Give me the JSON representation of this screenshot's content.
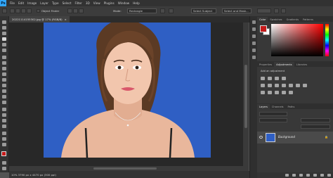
{
  "menu": [
    "File",
    "Edit",
    "Image",
    "Layer",
    "Type",
    "Select",
    "Filter",
    "3D",
    "View",
    "Plugins",
    "Window",
    "Help"
  ],
  "app_logo": "Ps",
  "options": {
    "object_finder": "Object Finder",
    "mode_label": "Mode:",
    "mode_value": "Rectangle",
    "select_subject": "Select Subject",
    "select_and_mask": "Select and Mask..."
  },
  "document": {
    "tab_title": "20221114155302.jpg @ 17% (RGB/8)",
    "status": "10%   3790 px x 4470 px (300 ppi)"
  },
  "color_panel": {
    "tabs": [
      "Color",
      "Swatches",
      "Gradients",
      "Patterns"
    ],
    "active": "Color",
    "foreground": "#c51a1a",
    "background": "#ffffff"
  },
  "adjust_panel": {
    "tabs": [
      "Properties",
      "Adjustments",
      "Libraries"
    ],
    "active": "Adjustments",
    "add_label": "Add an adjustment"
  },
  "layers_panel": {
    "tabs": [
      "Layers",
      "Channels",
      "Paths"
    ],
    "active": "Layers",
    "layer_name": "Background"
  },
  "colors": {
    "photo_bg": "#2f5fc4",
    "accent": "#31a8ff"
  }
}
